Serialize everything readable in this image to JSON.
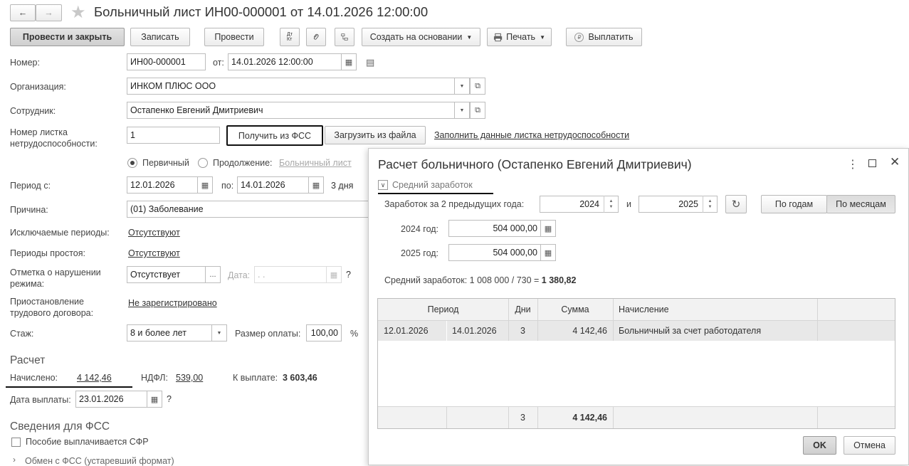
{
  "window": {
    "title": "Больничный лист ИН00-000001 от 14.01.2026 12:00:00",
    "back_icon": "arrow-left-icon",
    "forward_icon": "arrow-right-icon",
    "star_icon": "star-icon"
  },
  "toolbar": {
    "post_close": "Провести и закрыть",
    "save": "Записать",
    "post": "Провести",
    "dtkt": "Дт Кт",
    "create_based": "Создать на основании",
    "print": "Печать",
    "pay": "Выплатить"
  },
  "form": {
    "number_label": "Номер:",
    "number_value": "ИН00-000001",
    "from_label": "от:",
    "date_value": "14.01.2026 12:00:00",
    "org_label": "Организация:",
    "org_value": "ИНКОМ ПЛЮС ООО",
    "employee_label": "Сотрудник:",
    "employee_value": "Остапенко Евгений Дмитриевич",
    "sheet_label_1": "Номер листка",
    "sheet_label_2": "нетрудоспособности:",
    "sheet_value": "1",
    "get_fss": "Получить из ФСС",
    "load_file": "Загрузить из файла",
    "fill_link": "Заполнить данные листка нетрудоспособности",
    "radio_primary": "Первичный",
    "radio_continue": "Продолжение:",
    "continue_link": "Больничный лист",
    "period_label": "Период с:",
    "period_from": "12.01.2026",
    "period_to_label": "по:",
    "period_to": "14.01.2026",
    "days": "3 дня",
    "reason_label": "Причина:",
    "reason_value": "(01) Заболевание",
    "excluded_label": "Исключаемые периоды:",
    "excluded_value": "Отсутствуют",
    "idle_label": "Периоды простоя:",
    "idle_value": "Отсутствуют",
    "violation_label_1": "Отметка о нарушении",
    "violation_label_2": "режима:",
    "violation_value": "Отсутствует",
    "violation_date_label": "Дата:",
    "violation_date_value": " .  .",
    "question": "?",
    "suspend_label_1": "Приостановление",
    "suspend_label_2": "трудового договора:",
    "suspend_value": "Не зарегистрировано",
    "exp_label": "Стаж:",
    "exp_value": "8 и более лет",
    "payment_size_label": "Размер оплаты:",
    "payment_size_value": "100,00",
    "percent": "%"
  },
  "calc": {
    "section": "Расчет",
    "accrued_label": "Начислено:",
    "accrued_value": "4 142,46",
    "ndfl_label": "НДФЛ:",
    "ndfl_value": "539,00",
    "to_pay_label": "К выплате:",
    "to_pay_value": "3 603,46",
    "pay_date_label": "Дата выплаты:",
    "pay_date_value": "23.01.2026"
  },
  "fss": {
    "section": "Сведения для ФСС",
    "sfr_checkbox": "Пособие выплачивается СФР",
    "exchange": "Обмен с ФСС (устаревший формат)"
  },
  "dialog": {
    "title": "Расчет больничного (Остапенко Евгений Дмитриевич)",
    "avg_group": "Средний заработок",
    "earnings_label": "Заработок за 2 предыдущих года:",
    "year1": "2024",
    "and": "и",
    "year2": "2025",
    "by_years": "По годам",
    "by_months": "По месяцам",
    "year1_label": "2024 год:",
    "year1_amount": "504 000,00",
    "year2_label": "2025 год:",
    "year2_amount": "504 000,00",
    "avg_formula": "Средний заработок: 1 008 000 / 730 = ",
    "avg_result": "1 380,82",
    "table": {
      "headers": {
        "period": "Период",
        "days": "Дни",
        "sum": "Сумма",
        "accrual": "Начисление"
      },
      "rows": [
        {
          "from": "12.01.2026",
          "to": "14.01.2026",
          "days": "3",
          "sum": "4 142,46",
          "accrual": "Больничный за счет работодателя"
        }
      ],
      "footer": {
        "days": "3",
        "sum": "4 142,46"
      }
    },
    "ok": "OK",
    "cancel": "Отмена"
  }
}
